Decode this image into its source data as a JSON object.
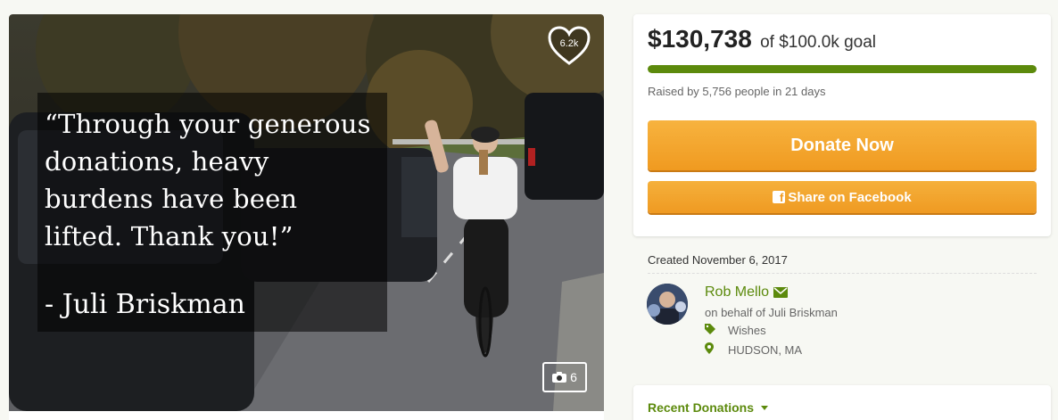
{
  "media": {
    "quote_lines": [
      "“Through your generous",
      "donations, heavy",
      "burdens have been",
      "lifted.  Thank you!”"
    ],
    "quote_author": "- Juli Briskman",
    "hearts_count": "6.2k",
    "photo_count": "6"
  },
  "campaign": {
    "amount_raised": "$130,738",
    "goal_text": "of $100.0k goal",
    "progress_fraction": 1.0,
    "raised_by_text": "Raised by 5,756 people in 21 days",
    "donate_label": "Donate Now",
    "share_label": "Share on Facebook"
  },
  "organizer": {
    "created_text": "Created November 6, 2017",
    "name": "Rob Mello",
    "behalf_text": "on behalf of Juli Briskman",
    "category": "Wishes",
    "location": "HUDSON, MA"
  },
  "recent": {
    "label": "Recent Donations"
  },
  "colors": {
    "accent_green": "#5c8a0c",
    "button_orange": "#f09a20"
  }
}
